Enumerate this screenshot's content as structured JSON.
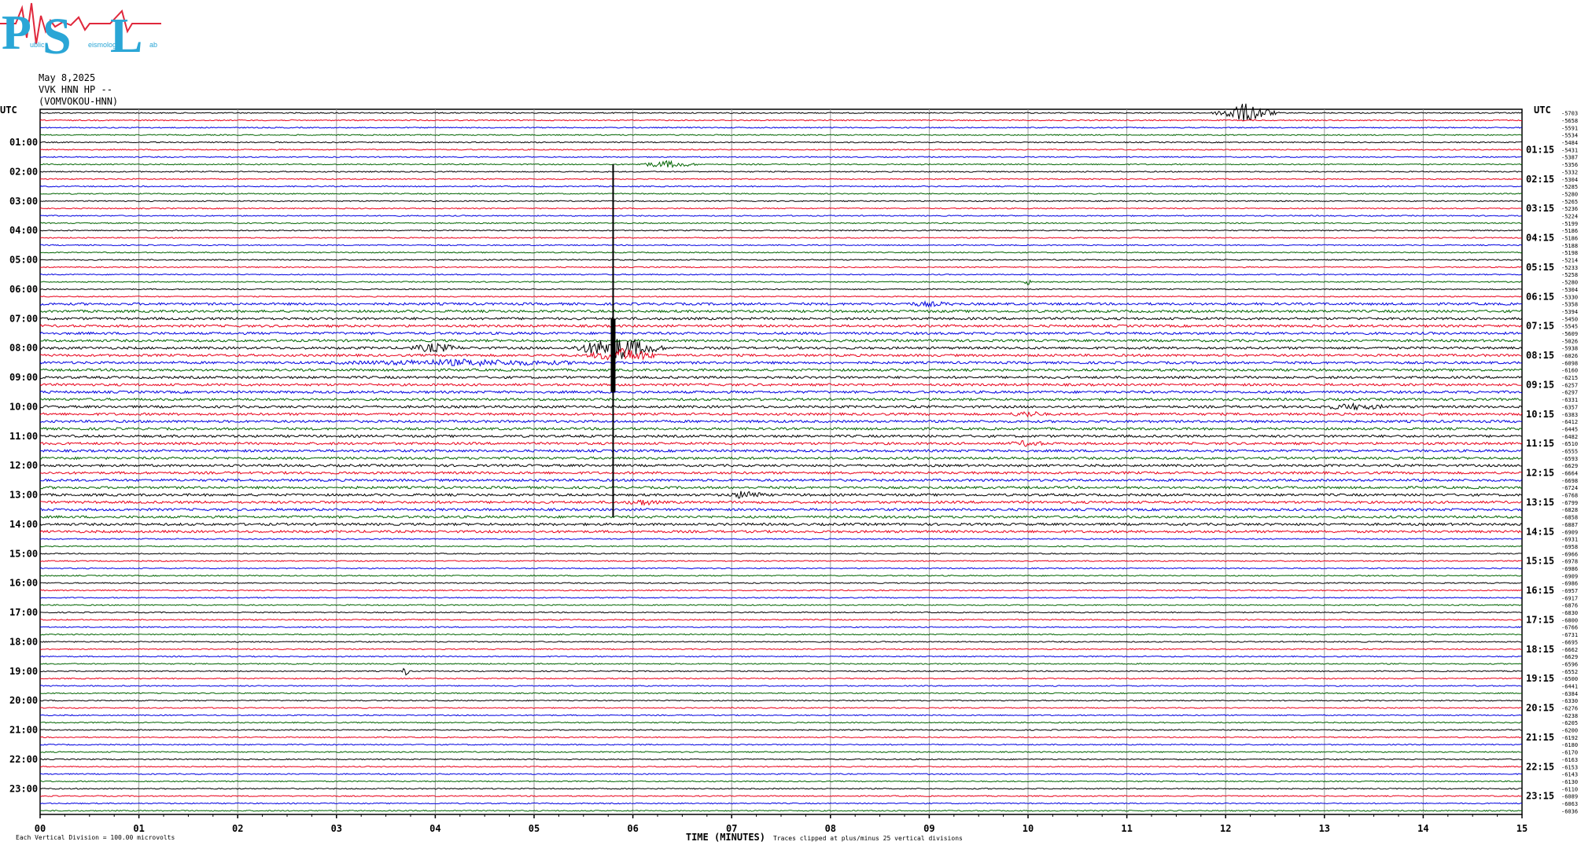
{
  "logo": {
    "letters": [
      "P",
      "S",
      "L"
    ],
    "caption_words": [
      "ublic",
      "eismology",
      "ab"
    ],
    "colors": {
      "letters": "#2aa6d6",
      "wave": "#e0283c"
    }
  },
  "header": {
    "date": "May 8,2025",
    "channel": "VVK HNN HP --",
    "station": "(VOMVOKOU-HNN)"
  },
  "chart_data": {
    "type": "line",
    "chart_kind": "helicorder",
    "left_axis_title": "UTC",
    "right_axis_title": "UTC",
    "left_labels": [
      "01:00",
      "02:00",
      "03:00",
      "04:00",
      "05:00",
      "06:00",
      "07:00",
      "08:00",
      "09:00",
      "10:00",
      "11:00",
      "12:00",
      "13:00",
      "14:00",
      "15:00",
      "16:00",
      "17:00",
      "18:00",
      "19:00",
      "20:00",
      "21:00",
      "22:00",
      "23:00"
    ],
    "right_labels": [
      "01:15",
      "02:15",
      "03:15",
      "04:15",
      "05:15",
      "06:15",
      "07:15",
      "08:15",
      "09:15",
      "10:15",
      "11:15",
      "12:15",
      "13:15",
      "14:15",
      "15:15",
      "16:15",
      "17:15",
      "18:15",
      "19:15",
      "20:15",
      "21:15",
      "22:15",
      "23:15"
    ],
    "x_ticks": [
      "00",
      "01",
      "02",
      "03",
      "04",
      "05",
      "06",
      "07",
      "08",
      "09",
      "10",
      "11",
      "12",
      "13",
      "14",
      "15"
    ],
    "xlim": [
      0,
      15
    ],
    "xlabel": "TIME (MINUTES)",
    "grid": true,
    "trace_colors": [
      "#000000",
      "#e8001a",
      "#0000e0",
      "#006400"
    ],
    "trace_count": 96,
    "row_offsets": [
      -5703,
      -5658,
      -5591,
      -5534,
      -5484,
      -5431,
      -5387,
      -5356,
      -5332,
      -5304,
      -5285,
      -5280,
      -5265,
      -5236,
      -5224,
      -5199,
      -5186,
      -5186,
      -5188,
      -5198,
      -5214,
      -5233,
      -5258,
      -5280,
      -5304,
      -5330,
      -5358,
      -5394,
      -5450,
      -5545,
      -5609,
      -5026,
      -5938,
      -6026,
      -6098,
      -6160,
      -6215,
      -6257,
      -6297,
      -6331,
      -6357,
      -6383,
      -6412,
      -6445,
      -6482,
      -6510,
      -6555,
      -6593,
      -6629,
      -6664,
      -6698,
      -6724,
      -6768,
      -6799,
      -6828,
      -6858,
      -6887,
      -6909,
      -6931,
      -6958,
      -6966,
      -6978,
      -6986,
      -6909,
      -6986,
      -6957,
      -6917,
      -6876,
      -6830,
      -6800,
      -6766,
      -6731,
      -6695,
      -6662,
      -6629,
      -6596,
      -6552,
      -6500,
      -6441,
      -6384,
      -6330,
      -6276,
      -6238,
      -6205,
      -6200,
      -6192,
      -6180,
      -6170,
      -6163,
      -6153,
      -6143,
      -6130,
      -6110,
      -6089,
      -6063,
      -6036
    ],
    "events": [
      {
        "row": 0,
        "minute": 12.2,
        "amp": 12,
        "dur": 0.35
      },
      {
        "row": 7,
        "minute": 6.35,
        "amp": 4,
        "dur": 0.35
      },
      {
        "row": 23,
        "minute": 10.0,
        "amp": 4,
        "dur": 0.05
      },
      {
        "row": 26,
        "minute": 9.0,
        "amp": 2,
        "dur": 0.3
      },
      {
        "row": 32,
        "minute": 4.0,
        "amp": 5,
        "dur": 0.3
      },
      {
        "row": 32,
        "minute": 5.85,
        "amp": 14,
        "dur": 0.5
      },
      {
        "row": 33,
        "minute": 5.9,
        "amp": 8,
        "dur": 0.4
      },
      {
        "row": 34,
        "minute": 4.3,
        "amp": 3,
        "dur": 1.5
      },
      {
        "row": 40,
        "minute": 13.3,
        "amp": 3,
        "dur": 0.4
      },
      {
        "row": 41,
        "minute": 10.0,
        "amp": 3,
        "dur": 0.2
      },
      {
        "row": 45,
        "minute": 10.0,
        "amp": 3,
        "dur": 0.2
      },
      {
        "row": 52,
        "minute": 7.15,
        "amp": 5,
        "dur": 0.2
      },
      {
        "row": 53,
        "minute": 6.1,
        "amp": 3,
        "dur": 0.2
      },
      {
        "row": 76,
        "minute": 3.7,
        "amp": 6,
        "dur": 0.05
      }
    ],
    "spike": {
      "minute": 5.8,
      "from_row": 7,
      "to_row": 55,
      "peak_row": 32
    },
    "noisy_rows": [
      26,
      27,
      28,
      29,
      30,
      31,
      32,
      33,
      34,
      35,
      36,
      37,
      38,
      39,
      40,
      41,
      42,
      43,
      44,
      45,
      46,
      47,
      48,
      49,
      50,
      51,
      52,
      53,
      54,
      55,
      56,
      57
    ]
  },
  "footer": {
    "left_note": "Each Vertical Division =  100.00 microvolts",
    "right_note": "Traces clipped at plus/minus 25 vertical divisions"
  }
}
